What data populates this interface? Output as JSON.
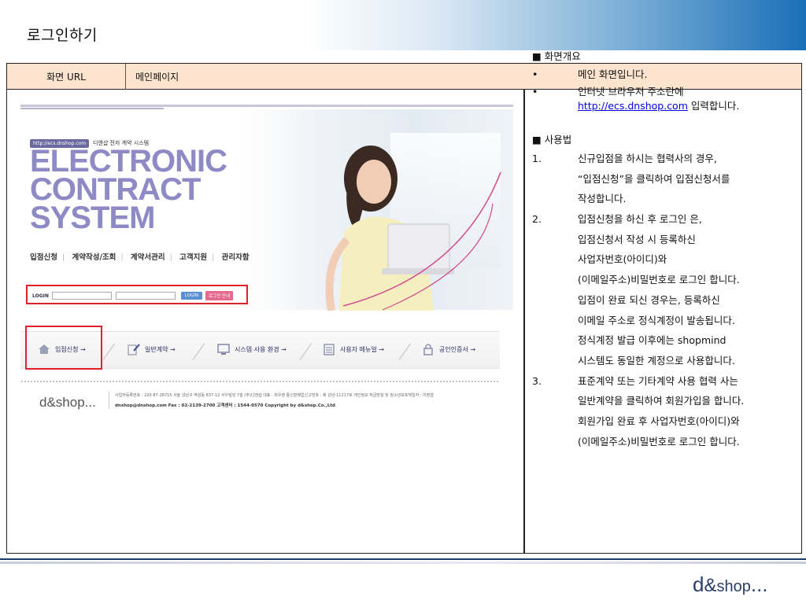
{
  "page": {
    "title": "로그인하기"
  },
  "url_row": {
    "label": "화면 URL",
    "value": "메인페이지"
  },
  "mockup": {
    "url_chip": "http://ecs.dnshop.com",
    "subtitle": "디앤샵 전자 계약 시스템",
    "big_title": [
      "ELECTRONIC",
      "CONTRACT",
      "SYSTEM"
    ],
    "nav": [
      "입점신청",
      "계약작성/조회",
      "계약서관리",
      "고객지원",
      "관리자함"
    ],
    "login": {
      "tag": "LOGIN",
      "login_button": "LOGIN",
      "guide_button": "로그인 안내"
    },
    "menu": [
      {
        "label": "입점신청 →",
        "icon": "home-icon"
      },
      {
        "label": "일반계약 →",
        "icon": "pen-icon"
      },
      {
        "label": "시스템 사용 환경 →",
        "icon": "monitor-icon"
      },
      {
        "label": "사용자 메뉴얼 →",
        "icon": "notebook-icon"
      },
      {
        "label": "공인인증서 →",
        "icon": "lock-icon"
      }
    ],
    "footer_logo": "d&shop...",
    "footer_line1": "사업자등록번호 : 220-87-28715  서울 강남구 역삼동 837-12 서우빌딩 7층 (주)디앤샵  대표 : 최우영  통신판매업신고번호 : 제 강남-11217호  개인정보 취급방침 및 청소년보호책임자 : 이정엽",
    "footer_line2": "dnshop@dnshop.com  Fax : 02-2139-2700  고객센터 : 1544-0570  Copyright by d&shop.Co.,Ltd"
  },
  "description": {
    "overview_title": "■ 화면개요",
    "overview": [
      {
        "marker": "•",
        "text": "메인 화면입니다."
      },
      {
        "marker": "•",
        "text_before": "인터넷 브라우저 주소란에",
        "link": "http://ecs.dnshop.com",
        "text_after": " 입력합니다."
      }
    ],
    "usage_title": "■ 사용법",
    "usage_lines": [
      {
        "marker": "1.",
        "text": "신규입점을 하시는 협력사의 경우,"
      },
      {
        "marker": "",
        "text": "“입점신청”을 클릭하여 입점신청서를"
      },
      {
        "marker": "",
        "text": "작성합니다."
      },
      {
        "marker": "2.",
        "text": "입점신청을 하신 후 로그인 은,"
      },
      {
        "marker": "",
        "text": "입점신청서 작성 시 등록하신"
      },
      {
        "marker": "",
        "text": "사업자번호(아이디)와"
      },
      {
        "marker": "",
        "text": "(이메일주소)비밀번호로 로그인 합니다."
      },
      {
        "marker": "",
        "text": "입점이 완료 되신 경우는, 등록하신"
      },
      {
        "marker": "",
        "text": "이메일 주소로 정식계정이 발송됩니다."
      },
      {
        "marker": "",
        "text": "정식계정 발급 이후에는 shopmind"
      },
      {
        "marker": "",
        "text": "시스템도 동일한 계정으로 사용합니다."
      },
      {
        "marker": "3.",
        "text": "표준계약 또는 기타계약 사용 협력 사는"
      },
      {
        "marker": "",
        "text": "일반계약을 클릭하여 회원가입을 합니다."
      },
      {
        "marker": "",
        "text": "회원가입 완료 후 사업자번호(아이디)와"
      },
      {
        "marker": "",
        "text": "(이메일주소)비밀번호로 로그인 합니다."
      }
    ]
  },
  "bottom_logo": {
    "d": "d",
    "amp": "&",
    "shop": "shop",
    "dots": "..."
  },
  "colors": {
    "accent_blue": "#1a6fb8",
    "highlight_red": "#e0212b",
    "url_row_bg": "#fde4cf",
    "title_purple": "#8d8ac6"
  }
}
